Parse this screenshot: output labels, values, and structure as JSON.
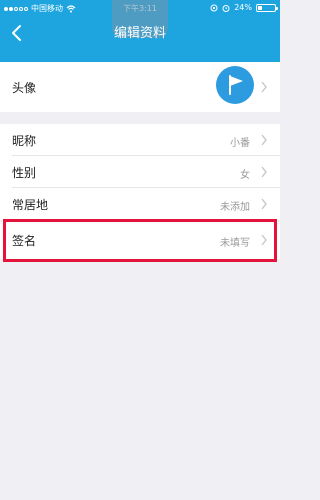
{
  "statusbar": {
    "carrier": "中国移动",
    "time": "下午3:11",
    "battery": "24%",
    "battery_level": 0.24
  },
  "nav": {
    "title": "编辑资料"
  },
  "avatar_row": {
    "label": "头像"
  },
  "rows": [
    {
      "label": "昵称",
      "value": "小番"
    },
    {
      "label": "性别",
      "value": "女"
    },
    {
      "label": "常居地",
      "value": "未添加"
    },
    {
      "label": "签名",
      "value": "未填写"
    }
  ],
  "colors": {
    "accent": "#1ea5e0",
    "highlight": "#e3133c"
  }
}
